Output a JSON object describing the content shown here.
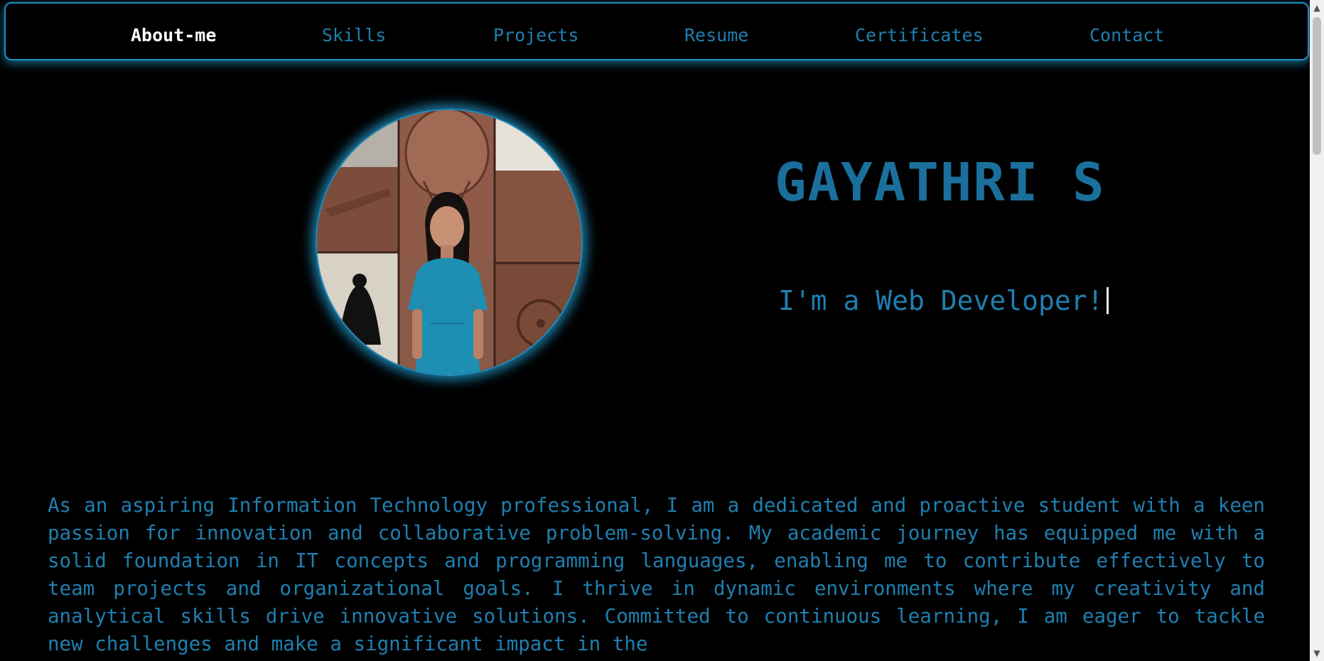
{
  "nav": {
    "items": [
      {
        "label": "About-me",
        "active": true
      },
      {
        "label": "Skills",
        "active": false
      },
      {
        "label": "Projects",
        "active": false
      },
      {
        "label": "Resume",
        "active": false
      },
      {
        "label": "Certificates",
        "active": false
      },
      {
        "label": "Contact",
        "active": false
      }
    ]
  },
  "hero": {
    "name": "GAYATHRI S",
    "tagline": "I'm a Web Developer!"
  },
  "about": {
    "text": "As an aspiring Information Technology professional, I am a dedicated and proactive student with a keen passion for innovation and collaborative problem-solving. My academic journey has equipped me with a solid foundation in IT concepts and programming languages, enabling me to contribute effectively to team projects and organizational goals. I thrive in dynamic environments where my creativity and analytical skills drive innovative solutions. Committed to continuous learning, I am eager to tackle new challenges and make a significant impact in the"
  },
  "theme": {
    "accent": "#1f8fc0",
    "text": "#1f7fb0",
    "background": "#000000",
    "active_nav": "#ffffff"
  },
  "icons": {
    "scroll_up": "triangle-up-icon",
    "scroll_down": "triangle-down-icon"
  }
}
